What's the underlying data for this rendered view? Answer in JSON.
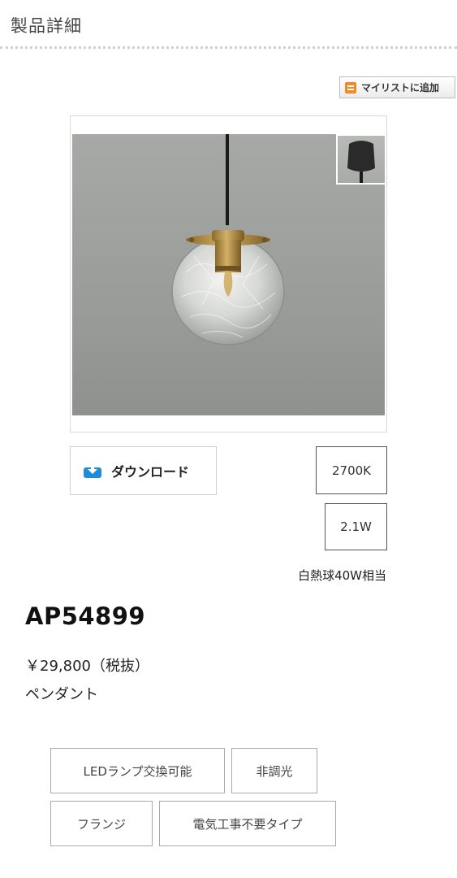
{
  "header": {
    "title": "製品詳細"
  },
  "actions": {
    "mylist_label": "マイリストに追加",
    "download_label": "ダウンロード"
  },
  "product": {
    "code": "AP54899",
    "price": "￥29,800（税抜）",
    "category": "ペンダント",
    "color_temperature": "2700K",
    "wattage": "2.1W",
    "equivalent": "白熱球40W相当"
  },
  "tags": [
    "LEDランプ交換可能",
    "非調光",
    "フランジ",
    "電気工事不要タイプ"
  ],
  "icons": {
    "mylist": "list-icon",
    "download": "download-icon"
  },
  "colors": {
    "accent_orange": "#f08a24",
    "download_blue": "#1f8dd6",
    "brass": "#b08d3e"
  }
}
